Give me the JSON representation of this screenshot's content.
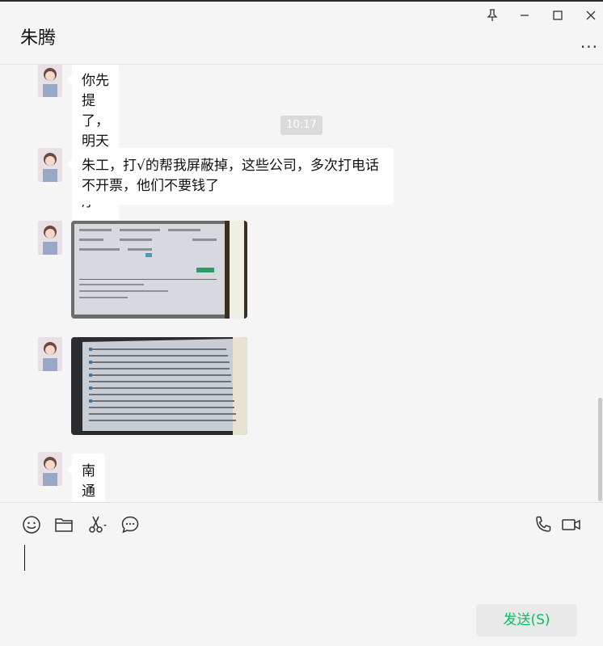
{
  "header": {
    "title": "朱腾",
    "more_label": "..."
  },
  "chat": {
    "timestamp": "10:17",
    "messages": [
      {
        "type": "text",
        "text": "你先提了，明天我看看程序"
      },
      {
        "type": "text",
        "text": "朱工，打√的帮我屏蔽掉，这些公司，多次打电话不开票，他们不要钱了"
      },
      {
        "type": "image",
        "content": "photo-of-monitor-screen"
      },
      {
        "type": "image",
        "content": "photo-of-monitor-table"
      },
      {
        "type": "text",
        "text": "南通三院"
      }
    ]
  },
  "toolbar": {
    "icons": [
      "emoji-icon",
      "folder-icon",
      "scissors-icon",
      "chat-bubble-icon",
      "phone-icon",
      "video-icon"
    ]
  },
  "composer": {
    "value": ""
  },
  "send": {
    "label": "发送(S)"
  },
  "colors": {
    "accent": "#07c160",
    "bubble": "#ffffff",
    "background": "#f5f5f5"
  }
}
